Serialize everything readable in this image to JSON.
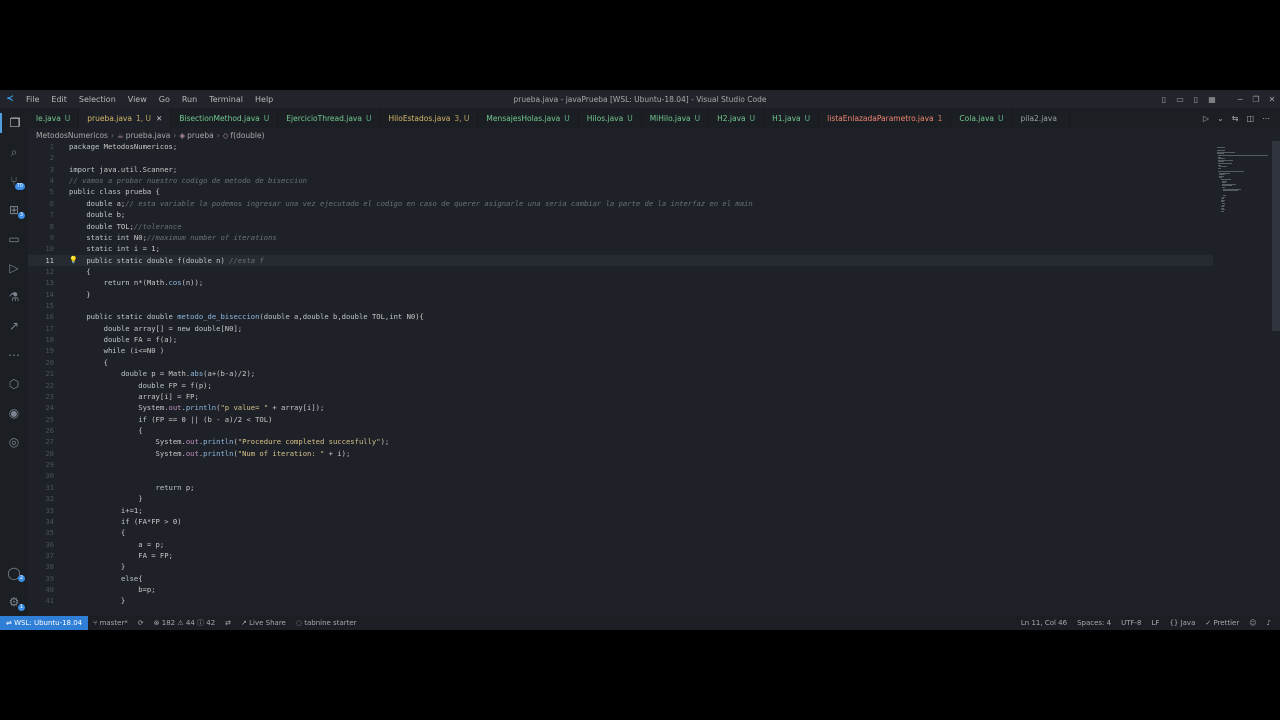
{
  "window": {
    "title": "prueba.java - javaPrueba [WSL: Ubuntu-18.04] - Visual Studio Code",
    "menus": [
      "File",
      "Edit",
      "Selection",
      "View",
      "Go",
      "Run",
      "Terminal",
      "Help"
    ]
  },
  "activity": [
    {
      "name": "explorer-icon",
      "glyph": "❐"
    },
    {
      "name": "search-icon",
      "glyph": "⌕"
    },
    {
      "name": "source-control-icon",
      "glyph": "⑂",
      "badge": "70"
    },
    {
      "name": "extensions-icon",
      "glyph": "⊞",
      "badge": "3"
    },
    {
      "name": "remote-explorer-icon",
      "glyph": "▭"
    },
    {
      "name": "run-debug-icon",
      "glyph": "▷"
    },
    {
      "name": "testing-icon",
      "glyph": "⚗"
    },
    {
      "name": "live-share-icon",
      "glyph": "↗"
    },
    {
      "name": "more-icon",
      "glyph": "⋯"
    },
    {
      "name": "docker-icon",
      "glyph": "⬡"
    },
    {
      "name": "github-icon",
      "glyph": "◉"
    },
    {
      "name": "edge-icon",
      "glyph": "◎"
    }
  ],
  "activity_bottom": [
    {
      "name": "accounts-icon",
      "glyph": "◯",
      "badge": "2"
    },
    {
      "name": "settings-gear-icon",
      "glyph": "⚙",
      "badge": "1"
    }
  ],
  "tabs": [
    {
      "label": "le.java",
      "status": "U",
      "color": "green"
    },
    {
      "label": "prueba.java",
      "status": "1, U",
      "color": "yellow",
      "active": true
    },
    {
      "label": "BisectionMethod.java",
      "status": "U",
      "color": "green"
    },
    {
      "label": "EjercicioThread.java",
      "status": "U",
      "color": "green"
    },
    {
      "label": "HiloEstados.java",
      "status": "3, U",
      "color": "yellow"
    },
    {
      "label": "MensajesHolas.java",
      "status": "U",
      "color": "green"
    },
    {
      "label": "Hilos.java",
      "status": "U",
      "color": "green"
    },
    {
      "label": "MiHilo.java",
      "status": "U",
      "color": "green"
    },
    {
      "label": "H2.java",
      "status": "U",
      "color": "green"
    },
    {
      "label": "H1.java",
      "status": "U",
      "color": "green"
    },
    {
      "label": "listaEnlazadaParametro.java",
      "status": "1",
      "color": "red"
    },
    {
      "label": "Cola.java",
      "status": "U",
      "color": "green"
    },
    {
      "label": "pila2.java",
      "status": "",
      "color": "grey"
    }
  ],
  "breadcrumb": {
    "folder": "MetodosNumericos",
    "file": "prueba.java",
    "klass": "prueba",
    "method": "f(double)"
  },
  "current_line": 11,
  "code": [
    {
      "n": 1,
      "t": "package MetodosNumericos;"
    },
    {
      "n": 2,
      "t": ""
    },
    {
      "n": 3,
      "t": "import java.util.Scanner;"
    },
    {
      "n": 4,
      "t": "// vamos a probar nuestro codigo de metodo de biseccion"
    },
    {
      "n": 5,
      "t": "public class prueba {"
    },
    {
      "n": 6,
      "t": "    double a;// esta variable la podemos ingresar una vez ejecutado el codigo en caso de querer asignarle una seria cambiar la parte de la interfaz en el main"
    },
    {
      "n": 7,
      "t": "    double b;"
    },
    {
      "n": 8,
      "t": "    double TOL;//tolerance"
    },
    {
      "n": 9,
      "t": "    static int N0;//maximum number of iterations"
    },
    {
      "n": 10,
      "t": "    static int i = 1;"
    },
    {
      "n": 11,
      "t": "    public static double f(double n) //esta f"
    },
    {
      "n": 12,
      "t": "    {"
    },
    {
      "n": 13,
      "t": "        return n*(Math.cos(n));"
    },
    {
      "n": 14,
      "t": "    }"
    },
    {
      "n": 15,
      "t": ""
    },
    {
      "n": 16,
      "t": "    public static double metodo_de_biseccion(double a,double b,double TOL,int N0){"
    },
    {
      "n": 17,
      "t": "        double array[] = new double[N0];"
    },
    {
      "n": 18,
      "t": "        double FA = f(a);"
    },
    {
      "n": 19,
      "t": "        while (i<=N0 )"
    },
    {
      "n": 20,
      "t": "        {"
    },
    {
      "n": 21,
      "t": "            double p = Math.abs(a+(b-a)/2);"
    },
    {
      "n": 22,
      "t": "                double FP = f(p);"
    },
    {
      "n": 23,
      "t": "                array[i] = FP;"
    },
    {
      "n": 24,
      "t": "                System.out.println(\"p value= \" + array[i]);"
    },
    {
      "n": 25,
      "t": "                if (FP == 0 || (b - a)/2 < TOL)"
    },
    {
      "n": 26,
      "t": "                {"
    },
    {
      "n": 27,
      "t": "                    System.out.println(\"Procedure completed succesfully\");"
    },
    {
      "n": 28,
      "t": "                    System.out.println(\"Num of iteration: \" + i);"
    },
    {
      "n": 29,
      "t": ""
    },
    {
      "n": 30,
      "t": ""
    },
    {
      "n": 31,
      "t": "                    return p;"
    },
    {
      "n": 32,
      "t": "                }"
    },
    {
      "n": 33,
      "t": "            i+=1;"
    },
    {
      "n": 34,
      "t": "            if (FA*FP > 0)"
    },
    {
      "n": 35,
      "t": "            {"
    },
    {
      "n": 36,
      "t": "                a = p;"
    },
    {
      "n": 37,
      "t": "                FA = FP;"
    },
    {
      "n": 38,
      "t": "            }"
    },
    {
      "n": 39,
      "t": "            else{"
    },
    {
      "n": 40,
      "t": "                b=p;"
    },
    {
      "n": 41,
      "t": "            }"
    }
  ],
  "status": {
    "remote": "WSL: Ubuntu-18.04",
    "branch": "master*",
    "errors": "182",
    "warnings": "44",
    "infos": "42",
    "live_share": "Live Share",
    "tabnine": "tabnine starter",
    "position": "Ln 11, Col 46",
    "spaces": "Spaces: 4",
    "encoding": "UTF-8",
    "eol": "LF",
    "language": "Java",
    "prettier": "Prettier"
  }
}
